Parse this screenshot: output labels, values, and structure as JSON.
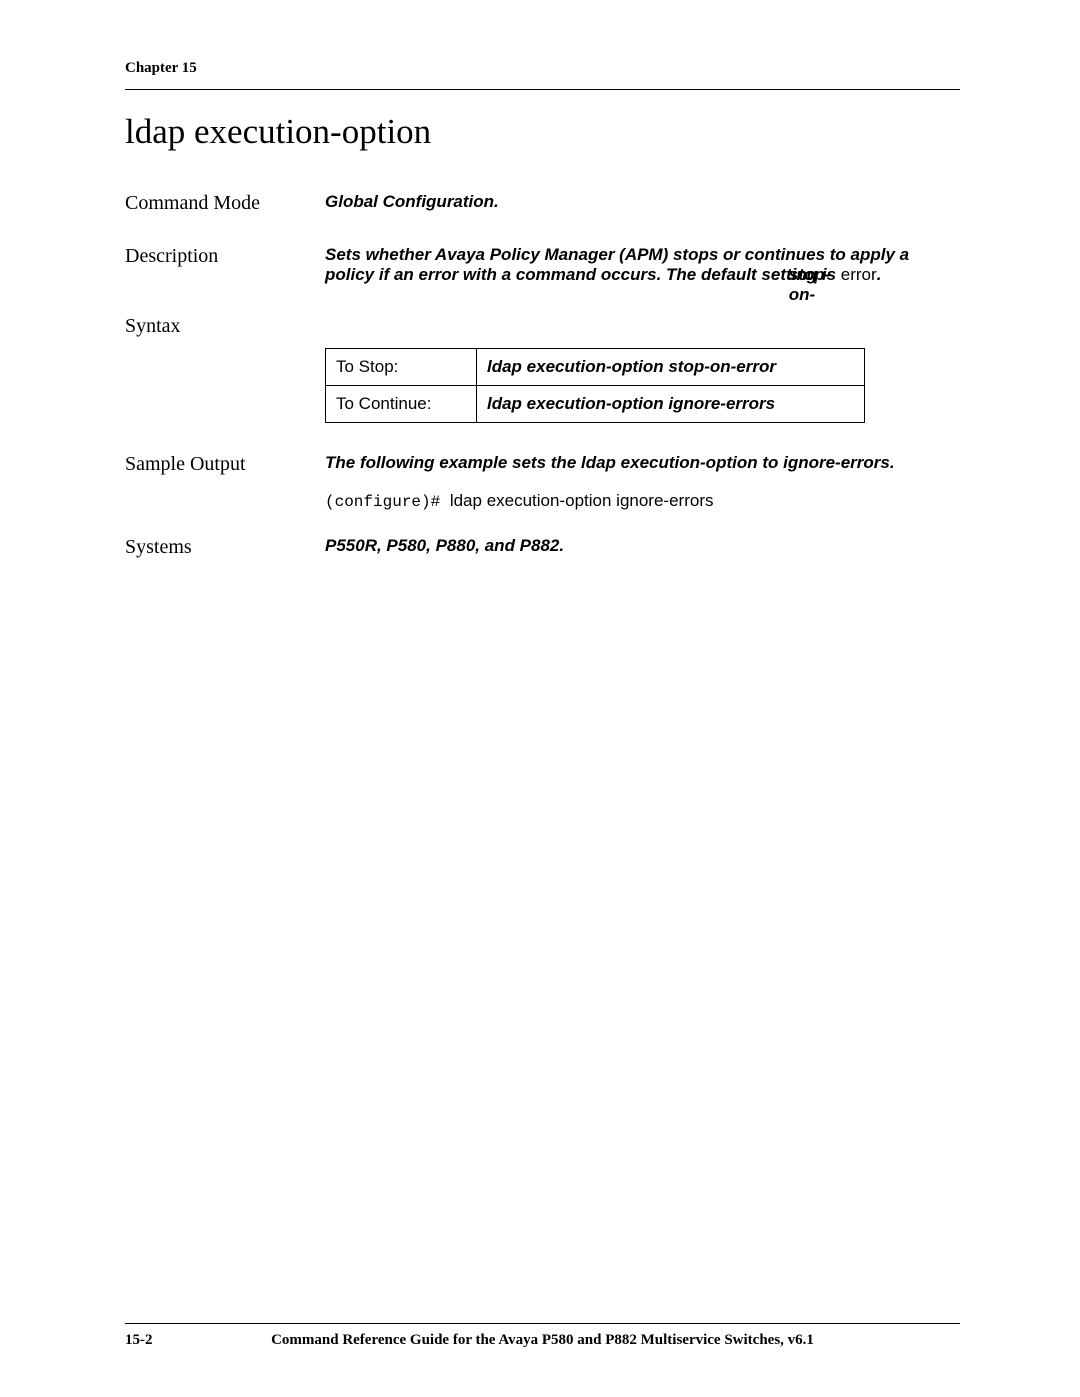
{
  "header": {
    "chapter": "Chapter 15"
  },
  "title": "ldap execution-option",
  "rows": {
    "command_mode": {
      "label": "Command Mode",
      "value": "Global Configuration."
    },
    "description": {
      "label": "Description",
      "part1": "Sets whether Avaya Policy Manager (APM) stops or continues to apply a policy if an error with a command occurs. The default setting is ",
      "overlay": "stop-on-",
      "plain": "error",
      "part2": "."
    },
    "syntax": {
      "label": "Syntax",
      "table": [
        {
          "label": "To Stop:",
          "cmd": "ldap execution-option stop-on-error"
        },
        {
          "label": "To Continue:",
          "cmd": "ldap execution-option ignore-errors"
        }
      ]
    },
    "sample_output": {
      "label": "Sample Output",
      "intro": "The following example sets the ldap execution-option to ignore-errors.",
      "prompt": "(configure)# ",
      "command": "ldap execution-option ignore-errors"
    },
    "systems": {
      "label": "Systems",
      "value": "P550R, P580, P880, and P882."
    }
  },
  "footer": {
    "page_num": "15-2",
    "doc_title": "Command Reference Guide for the Avaya P580 and P882 Multiservice Switches, v6.1"
  }
}
